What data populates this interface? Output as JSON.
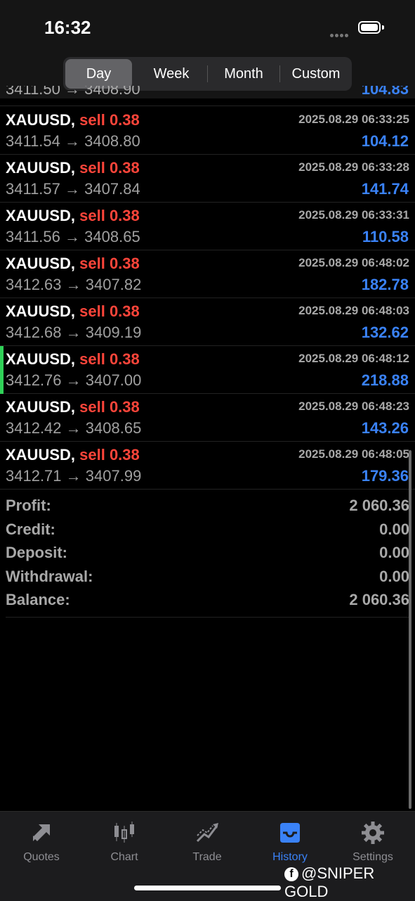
{
  "status_bar": {
    "time": "16:32"
  },
  "period_tabs": [
    {
      "label": "Day",
      "active": true
    },
    {
      "label": "Week",
      "active": false
    },
    {
      "label": "Month",
      "active": false
    },
    {
      "label": "Custom",
      "active": false
    }
  ],
  "clipped_row": {
    "prices": "3411.50 → 3408.90",
    "profit": "104.83"
  },
  "deals": [
    {
      "symbol": "XAUUSD,",
      "side": "sell 0.38",
      "open": "3411.54",
      "arrow": "→",
      "close": "3408.80",
      "time": "2025.08.29 06:33:25",
      "profit": "104.12"
    },
    {
      "symbol": "XAUUSD,",
      "side": "sell 0.38",
      "open": "3411.57",
      "arrow": "→",
      "close": "3407.84",
      "time": "2025.08.29 06:33:28",
      "profit": "141.74"
    },
    {
      "symbol": "XAUUSD,",
      "side": "sell 0.38",
      "open": "3411.56",
      "arrow": "→",
      "close": "3408.65",
      "time": "2025.08.29 06:33:31",
      "profit": "110.58"
    },
    {
      "symbol": "XAUUSD,",
      "side": "sell 0.38",
      "open": "3412.63",
      "arrow": "→",
      "close": "3407.82",
      "time": "2025.08.29 06:48:02",
      "profit": "182.78"
    },
    {
      "symbol": "XAUUSD,",
      "side": "sell 0.38",
      "open": "3412.68",
      "arrow": "→",
      "close": "3409.19",
      "time": "2025.08.29 06:48:03",
      "profit": "132.62"
    },
    {
      "symbol": "XAUUSD,",
      "side": "sell 0.38",
      "open": "3412.76",
      "arrow": "→",
      "close": "3407.00",
      "time": "2025.08.29 06:48:12",
      "profit": "218.88"
    },
    {
      "symbol": "XAUUSD,",
      "side": "sell 0.38",
      "open": "3412.42",
      "arrow": "→",
      "close": "3408.65",
      "time": "2025.08.29 06:48:23",
      "profit": "143.26"
    },
    {
      "symbol": "XAUUSD,",
      "side": "sell 0.38",
      "open": "3412.71",
      "arrow": "→",
      "close": "3407.99",
      "time": "2025.08.29 06:48:05",
      "profit": "179.36"
    }
  ],
  "summary": [
    {
      "label": "Profit:",
      "value": "2 060.36"
    },
    {
      "label": "Credit:",
      "value": "0.00"
    },
    {
      "label": "Deposit:",
      "value": "0.00"
    },
    {
      "label": "Withdrawal:",
      "value": "0.00"
    },
    {
      "label": "Balance:",
      "value": "2 060.36"
    }
  ],
  "tabbar": [
    {
      "label": "Quotes",
      "icon": "quotes-arrows-icon",
      "active": false
    },
    {
      "label": "Chart",
      "icon": "candlestick-chart-icon",
      "active": false
    },
    {
      "label": "Trade",
      "icon": "trade-trend-icon",
      "active": false
    },
    {
      "label": "History",
      "icon": "history-inbox-icon",
      "active": true
    },
    {
      "label": "Settings",
      "icon": "gear-icon",
      "active": false
    }
  ],
  "watermark": {
    "text": "@SNIPER GOLD",
    "icon": "facebook-icon"
  },
  "colors": {
    "sell": "#ff453a",
    "profit": "#3a82f7",
    "active_tab": "#3a82f7",
    "marker": "#30d158"
  }
}
